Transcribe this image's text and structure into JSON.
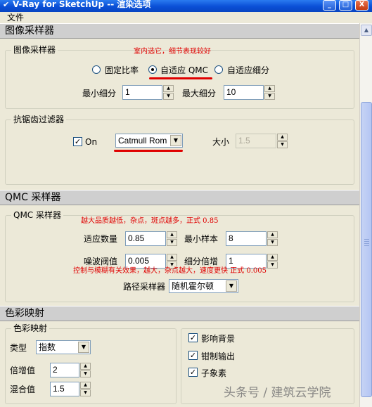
{
  "window": {
    "title": "V-Ray for SketchUp -- 渲染选项",
    "icon": "vray-icon",
    "min_glyph": "_",
    "max_glyph": "□",
    "close_glyph": "X"
  },
  "menu": {
    "file": "文件"
  },
  "image_sampler": {
    "header": "图像采样器",
    "group_label": "图像采样器",
    "note": "室内选它，细节表现较好",
    "radio_fixed": "固定比率",
    "radio_adaptive_qmc": "自适应 QMC",
    "radio_adaptive_subdiv": "自适应细分",
    "selected": "自适应 QMC",
    "min_subdiv_label": "最小细分",
    "min_subdiv_value": "1",
    "max_subdiv_label": "最大细分",
    "max_subdiv_value": "10"
  },
  "aa_filter": {
    "group_label": "抗锯齿过滤器",
    "on_label": "On",
    "on_checked": true,
    "filter_value": "Catmull Rom",
    "size_label": "大小",
    "size_value": "1.5"
  },
  "qmc_sampler": {
    "header": "QMC 采样器",
    "group_label": "QMC 采样器",
    "note1": "越大品质越低，杂点，斑点越多，正式 0.85",
    "adaptive_amount_label": "适应数量",
    "adaptive_amount_value": "0.85",
    "min_samples_label": "最小样本",
    "min_samples_value": "8",
    "noise_threshold_label": "噪波阀值",
    "noise_threshold_value": "0.005",
    "subdiv_mult_label": "细分倍增",
    "subdiv_mult_value": "1",
    "note2": "控制与模糊有关效果，越大，杂点越大，速度更快 正式 0.005",
    "path_sampler_label": "路径采样器",
    "path_sampler_value": "随机霍尔顿"
  },
  "color_mapping": {
    "header": "色彩映射",
    "group_label": "色彩映射",
    "type_label": "类型",
    "type_value": "指数",
    "multiplier_label": "倍增值",
    "multiplier_value": "2",
    "blend_label": "混合值",
    "blend_value": "1.5",
    "affect_bg_label": "影响背景",
    "clamp_output_label": "钳制输出",
    "subpixel_label": "子象素"
  },
  "watermark": "头条号 / 建筑云学院"
}
